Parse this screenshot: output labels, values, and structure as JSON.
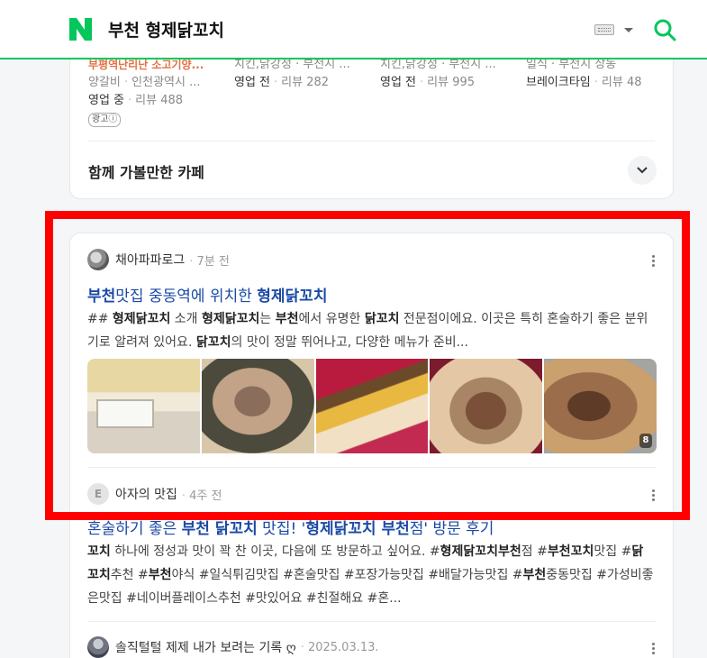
{
  "header": {
    "logo_alt": "N",
    "query": "부천 형제닭꼬치",
    "brand_color": "#03c75a"
  },
  "places": [
    {
      "category": "부평역난리난 소고기양...",
      "meta_main": "양갈비",
      "meta_sub": "인천광역시 ...",
      "status": "영업 중",
      "reviews": "리뷰 488",
      "ad": "광고ⓘ"
    },
    {
      "category": "치킨,닭강정 · 부천시 ...",
      "status": "영업 전",
      "reviews": "리뷰 282"
    },
    {
      "category": "치킨,닭강정 · 부천시 ...",
      "status": "영업 전",
      "reviews": "리뷰 995"
    },
    {
      "category": "일식 · 부천시 상동",
      "status": "브레이크타임",
      "reviews": "리뷰 48"
    }
  ],
  "cafe_section": {
    "title": "함께 가볼만한 카페"
  },
  "posts": [
    {
      "author": "채아파파로그",
      "time": "7분 전",
      "title_parts": [
        {
          "t": "부천",
          "b": true
        },
        {
          "t": "맛집 중동역에 위치한 ",
          "b": false
        },
        {
          "t": "형제닭꼬치",
          "b": true
        }
      ],
      "desc_parts": [
        {
          "t": "## ",
          "b": false
        },
        {
          "t": "형제닭꼬치",
          "b": true
        },
        {
          "t": " 소개 ",
          "b": false
        },
        {
          "t": "형제닭꼬치",
          "b": true
        },
        {
          "t": "는 ",
          "b": false
        },
        {
          "t": "부천",
          "b": true
        },
        {
          "t": "에서 유명한 ",
          "b": false
        },
        {
          "t": "닭꼬치",
          "b": true
        },
        {
          "t": " 전문점이에요. 이곳은 특히 혼술하기 좋은 분위기로 알려져 있어요. ",
          "b": false
        },
        {
          "t": "닭꼬치",
          "b": true
        },
        {
          "t": "의 맛이 정말 뛰어나고, 다양한 메뉴가 준비...",
          "b": false
        }
      ],
      "image_count": "8"
    },
    {
      "author": "아자의 맛집",
      "avatar_letter": "E",
      "time": "4주 전",
      "title_parts": [
        {
          "t": "혼술하기 좋은 ",
          "b": false
        },
        {
          "t": "부천 닭꼬치",
          "b": true
        },
        {
          "t": " 맛집! '",
          "b": false
        },
        {
          "t": "형제닭꼬치 부천",
          "b": true
        },
        {
          "t": "점' 방문 후기",
          "b": false
        }
      ],
      "desc_parts": [
        {
          "t": "꼬치",
          "b": true
        },
        {
          "t": " 하나에 정성과 맛이 꽉 찬 이곳, 다음에 또 방문하고 싶어요. #",
          "b": false
        },
        {
          "t": "형제닭꼬치부천",
          "b": true
        },
        {
          "t": "점 #",
          "b": false
        },
        {
          "t": "부천꼬치",
          "b": true
        },
        {
          "t": "맛집 #",
          "b": false
        },
        {
          "t": "닭꼬치",
          "b": true
        },
        {
          "t": "추천 #",
          "b": false
        },
        {
          "t": "부천",
          "b": true
        },
        {
          "t": "야식 #일식튀김맛집 #혼술맛집 #포장가능맛집 #배달가능맛집 #",
          "b": false
        },
        {
          "t": "부천",
          "b": true
        },
        {
          "t": "중동맛집 #가성비좋은맛집 #네이버플레이스추천 #맛있어요 #친절해요 #혼...",
          "b": false
        }
      ]
    },
    {
      "author": "솔직털털 제제 내가 보려는 기록 ღ",
      "time": "2025.03.13."
    }
  ],
  "highlight_color": "#ff0000"
}
